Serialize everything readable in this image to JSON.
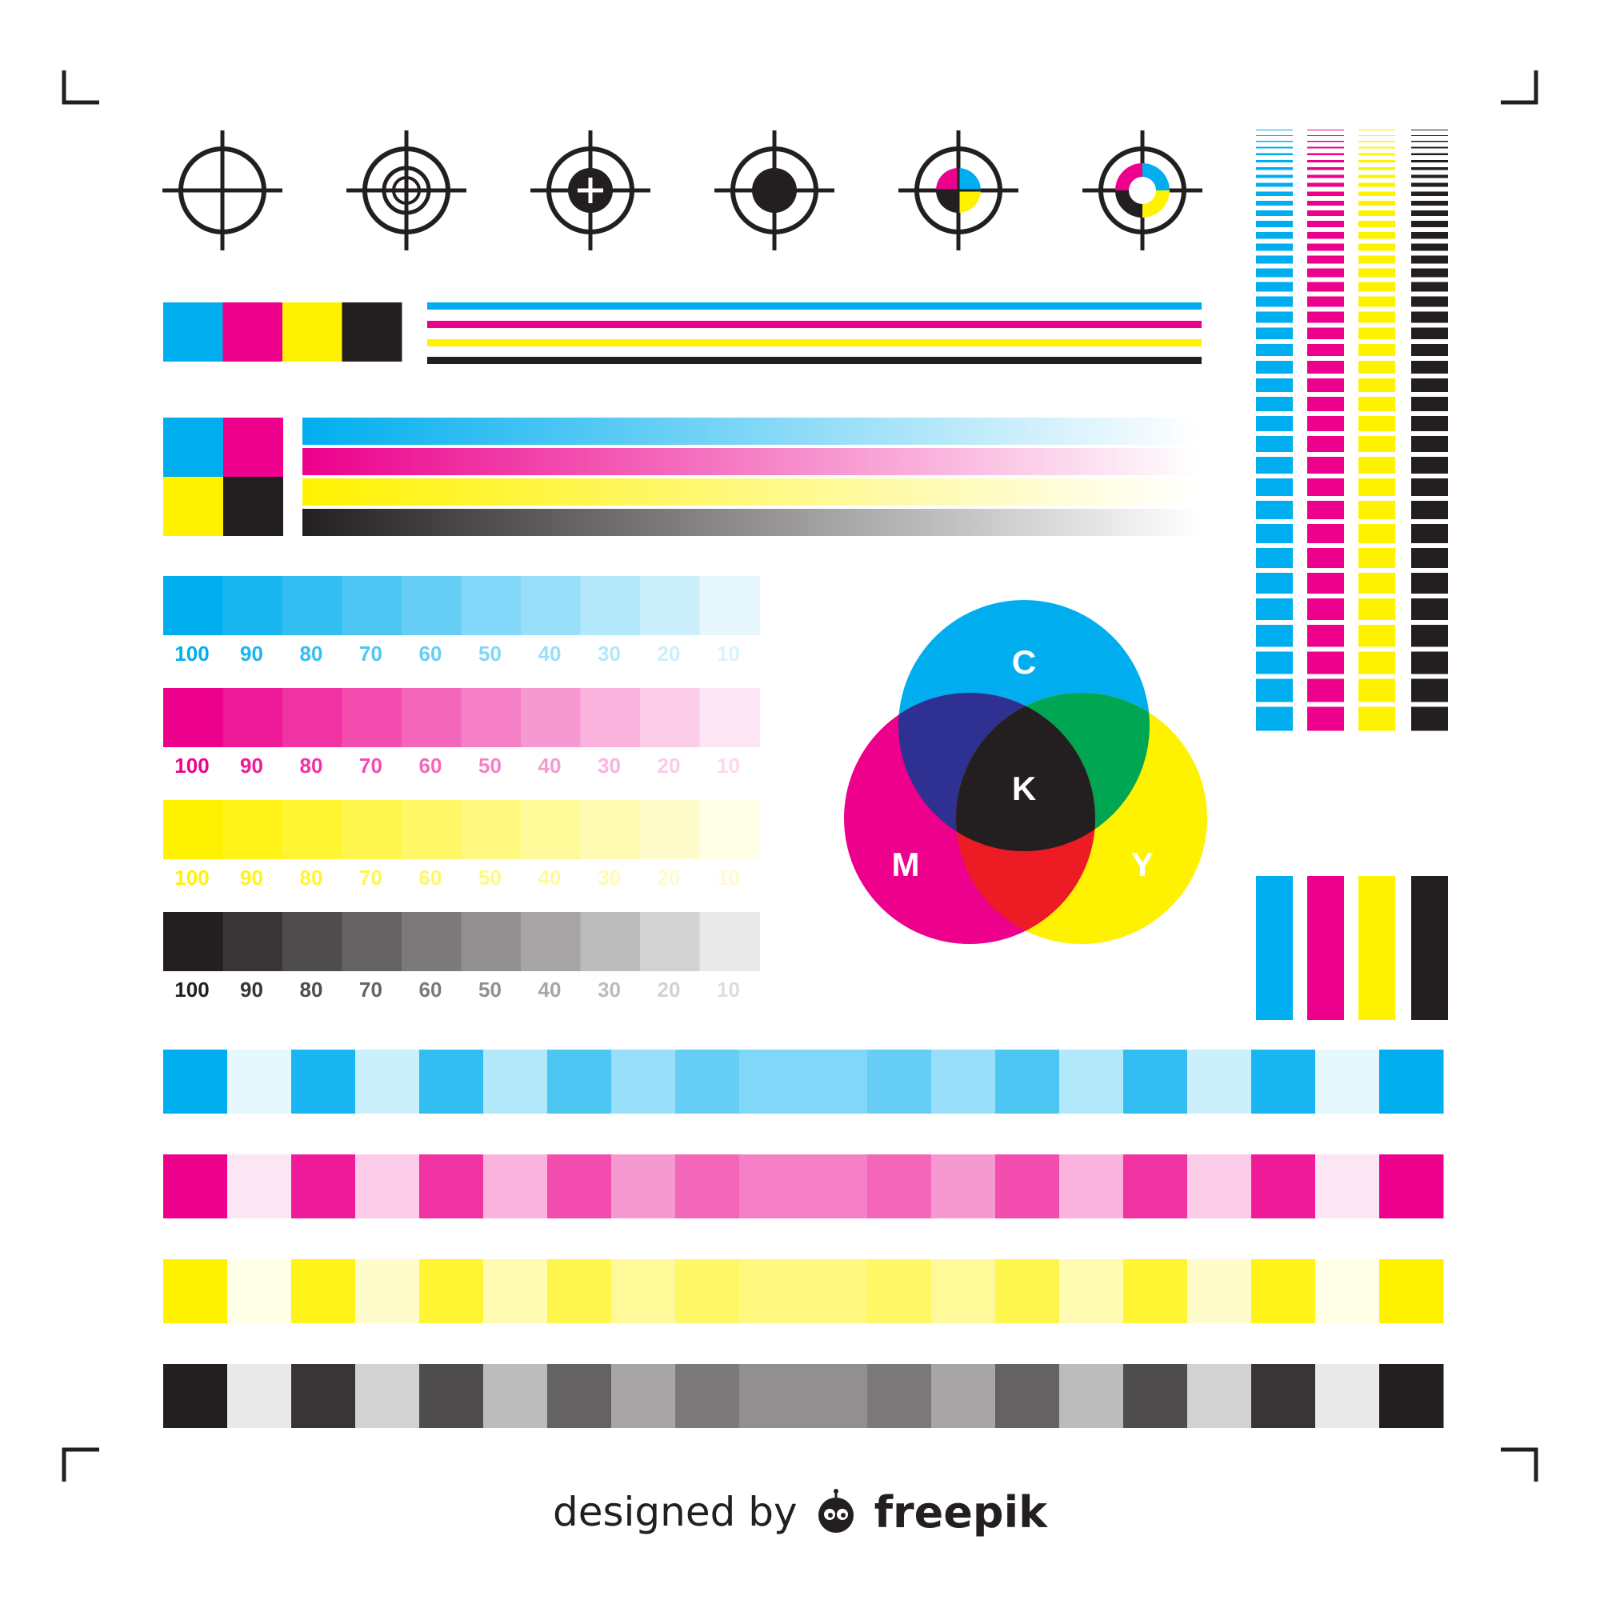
{
  "colors": {
    "cyan": "#00aeef",
    "magenta": "#ec008c",
    "yellow": "#fff200",
    "black": "#231f20",
    "blue_overlap": "#2e3192",
    "green_overlap": "#00a651",
    "red_overlap": "#ed1c24",
    "white": "#ffffff"
  },
  "registration_marks": [
    {
      "style": "plain",
      "icon": "crosshair-icon"
    },
    {
      "style": "double-ring",
      "icon": "double-ring-crosshair-icon"
    },
    {
      "style": "center-cross",
      "icon": "crosshair-plus-icon"
    },
    {
      "style": "solid-center",
      "icon": "crosshair-dot-icon"
    },
    {
      "style": "cmyk-center",
      "icon": "cmyk-crosshair-icon"
    },
    {
      "style": "cmyk-ring",
      "icon": "cmyk-ring-crosshair-icon"
    }
  ],
  "ink_order": [
    "cyan",
    "magenta",
    "yellow",
    "black"
  ],
  "tint_scale": {
    "labels": [
      "100",
      "90",
      "80",
      "70",
      "60",
      "50",
      "40",
      "30",
      "20",
      "10"
    ],
    "values": [
      100,
      90,
      80,
      70,
      60,
      50,
      40,
      30,
      20,
      10
    ]
  },
  "mixing_diagram": {
    "labels": {
      "cyan": "C",
      "magenta": "M",
      "yellow": "Y",
      "key": "K"
    }
  },
  "bottom_strips": {
    "tints": [
      100,
      10,
      90,
      20,
      80,
      30,
      70,
      40,
      60,
      50,
      50,
      60,
      40,
      70,
      30,
      80,
      20,
      90,
      10,
      100
    ]
  },
  "vertical_bars": {
    "line_widths": [
      1,
      1,
      1.5,
      2,
      2.5,
      3,
      3.5,
      4,
      5,
      5.5,
      6,
      7,
      8,
      8.5,
      9,
      10,
      11,
      12,
      13,
      14,
      14.5,
      15,
      16,
      17,
      18,
      19,
      20,
      21,
      22,
      23,
      24,
      25,
      26,
      27,
      27.5,
      28,
      29,
      30
    ]
  },
  "footer": {
    "designed_by": "designed by",
    "brand": "freepik",
    "logo_icon": "freepik-logo-icon"
  }
}
